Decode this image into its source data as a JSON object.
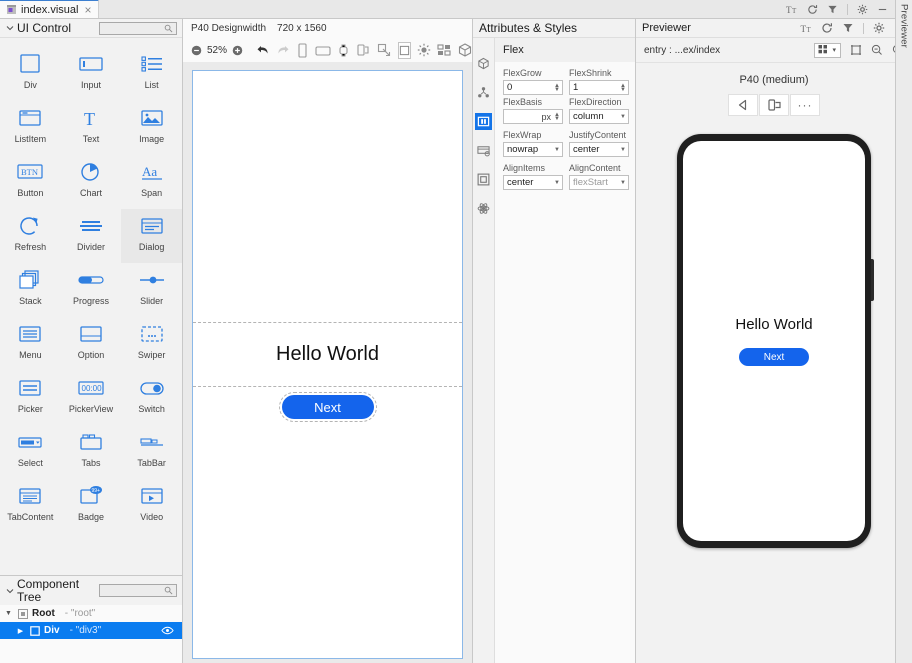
{
  "tab": {
    "title": "index.visual",
    "close": "×",
    "icon": "visual-file-icon"
  },
  "titlebar_icons": [
    "text-size-icon",
    "sync-icon",
    "filter-icon",
    "settings-icon",
    "minimize-icon"
  ],
  "left_panel": {
    "title": "UI Control",
    "search_placeholder": "",
    "search_value": "",
    "components": [
      {
        "label": "Div",
        "icon": "div-icon"
      },
      {
        "label": "Input",
        "icon": "input-icon"
      },
      {
        "label": "List",
        "icon": "list-icon"
      },
      {
        "label": "ListItem",
        "icon": "listitem-icon"
      },
      {
        "label": "Text",
        "icon": "text-icon"
      },
      {
        "label": "Image",
        "icon": "image-icon"
      },
      {
        "label": "Button",
        "icon": "button-icon"
      },
      {
        "label": "Chart",
        "icon": "chart-icon"
      },
      {
        "label": "Span",
        "icon": "span-icon"
      },
      {
        "label": "Refresh",
        "icon": "refresh-icon"
      },
      {
        "label": "Divider",
        "icon": "divider-icon"
      },
      {
        "label": "Dialog",
        "icon": "dialog-icon"
      },
      {
        "label": "Stack",
        "icon": "stack-icon"
      },
      {
        "label": "Progress",
        "icon": "progress-icon"
      },
      {
        "label": "Slider",
        "icon": "slider-icon"
      },
      {
        "label": "Menu",
        "icon": "menu-icon"
      },
      {
        "label": "Option",
        "icon": "option-icon"
      },
      {
        "label": "Swiper",
        "icon": "swiper-icon"
      },
      {
        "label": "Picker",
        "icon": "picker-icon"
      },
      {
        "label": "PickerView",
        "icon": "pickerview-icon"
      },
      {
        "label": "Switch",
        "icon": "switch-icon"
      },
      {
        "label": "Select",
        "icon": "select-icon"
      },
      {
        "label": "Tabs",
        "icon": "tabs-icon"
      },
      {
        "label": "TabBar",
        "icon": "tabbar-icon"
      },
      {
        "label": "TabContent",
        "icon": "tabcontent-icon"
      },
      {
        "label": "Badge",
        "icon": "badge-icon"
      },
      {
        "label": "Video",
        "icon": "video-icon"
      }
    ],
    "pickerview_text": "00:00",
    "button_text": "BTN",
    "span_text": "Aa",
    "badge_text": "99+"
  },
  "component_tree": {
    "title": "Component Tree",
    "search_value": "",
    "rows": [
      {
        "name": "Root",
        "value": "- \"root\"",
        "icon": "root-icon",
        "selected": false
      },
      {
        "name": "Div",
        "value": "- \"div3\"",
        "icon": "div-node-icon",
        "selected": true
      }
    ]
  },
  "canvas": {
    "device_label": "P40 Designwidth",
    "resolution": "720 x 1560",
    "zoom": "52%",
    "zoom_out": "−",
    "zoom_in": "+",
    "tools": [
      "undo-icon",
      "redo-icon",
      "phone-device-icon",
      "tablet-device-icon",
      "watch-device-icon",
      "foldable-device-icon",
      "resize-icon",
      "frame-icon",
      "brightness-icon",
      "layout-icon",
      "3d-icon"
    ],
    "hello_text": "Hello World",
    "button_text": "Next"
  },
  "attributes": {
    "title": "Attributes & Styles",
    "rail_icons": [
      "3d-box-icon",
      "structure-icon",
      "layout-columns-icon",
      "card-icon",
      "frame-box-icon",
      "atom-icon"
    ],
    "section_title": "Flex",
    "fields": [
      {
        "label": "FlexGrow",
        "value": "0",
        "type": "spinner"
      },
      {
        "label": "FlexShrink",
        "value": "1",
        "type": "spinner"
      },
      {
        "label": "FlexBasis",
        "value": "",
        "unit": "px",
        "type": "spinner"
      },
      {
        "label": "FlexDirection",
        "value": "column",
        "type": "select"
      },
      {
        "label": "FlexWrap",
        "value": "nowrap",
        "type": "select"
      },
      {
        "label": "JustifyContent",
        "value": "center",
        "type": "select"
      },
      {
        "label": "AlignItems",
        "value": "center",
        "type": "select"
      },
      {
        "label": "AlignContent",
        "value": "flexStart",
        "type": "select"
      }
    ]
  },
  "previewer": {
    "title": "Previewer",
    "tools": [
      "text-size-icon",
      "refresh-icon",
      "filter-icon",
      "settings-icon",
      "minimize-icon"
    ],
    "entry": "entry : ...ex/index",
    "view_mode_icon": "grid-view-icon",
    "dropdown_caret": "▾",
    "frame_icon": "frame-icon",
    "zoom_out_icon": "zoom-out-icon",
    "zoom_in_icon": "zoom-in-icon",
    "device_name": "P40 (medium)",
    "device_buttons": [
      "back-triangle-icon",
      "rotate-device-icon",
      "more-options-icon"
    ],
    "more_label": "···",
    "screen_hello": "Hello World",
    "screen_button": "Next",
    "vertical_tab": "Previewer"
  },
  "colors": {
    "accent_blue": "#1464ec",
    "icon_blue": "#2f7fe0",
    "selection_blue": "#0a7cf0",
    "panel_bg": "#f2f2f2",
    "canvas_bg": "#eaeaea"
  }
}
